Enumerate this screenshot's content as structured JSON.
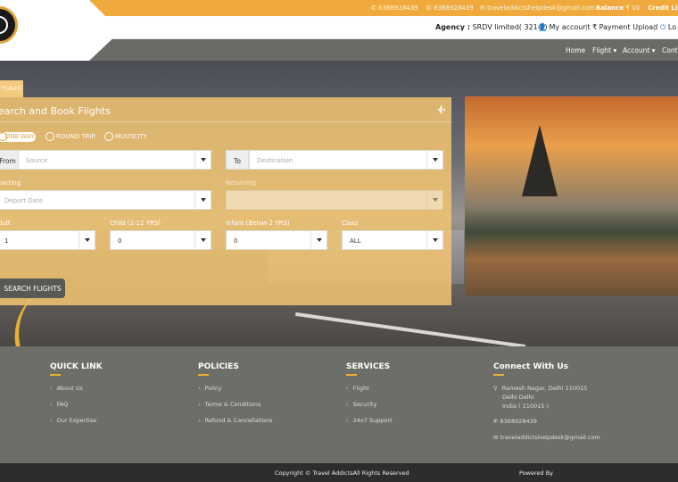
{
  "topbar": {
    "phone1": "8368928439",
    "phone2": "8368928439",
    "email": "traveladdictshelpdesk@gmail.com",
    "balance_label": "Balance",
    "balance_value": "₹ 10",
    "credit_label": "Credit Limi"
  },
  "agency": {
    "label": "Agency :",
    "name": "SRDV limited( 3214 )",
    "my_account": "My account",
    "payment_upload": "Payment Upload",
    "logout": "Lo"
  },
  "nav": {
    "items": [
      "Home",
      "Flight",
      "Account",
      "Conta"
    ]
  },
  "search": {
    "tab_label": "FLIGHT",
    "title": "earch and Book Flights",
    "trip_types": [
      "ONE WAY",
      "ROUND TRIP",
      "MULTICITY"
    ],
    "from_label": "From",
    "from_placeholder": "Source",
    "to_label": "To",
    "to_placeholder": "Destination",
    "departing_label": "parting",
    "depart_placeholder": "Depart Date",
    "returning_label": "Returning",
    "adult_label": "dult",
    "adult_value": "1",
    "child_label": "Child (2-12 YRS)",
    "child_value": "0",
    "infant_label": "Infant (Below 2 YRS)",
    "infant_value": "0",
    "class_label": "Class",
    "class_value": "ALL",
    "button": "SEARCH FLIGHTS"
  },
  "footer": {
    "quick_link": {
      "heading": "QUICK LINK",
      "items": [
        "About Us",
        "FAQ",
        "Our Expertise"
      ]
    },
    "policies": {
      "heading": "POLICIES",
      "items": [
        "Policy",
        "Terms & Conditions",
        "Refund & Cancellations"
      ]
    },
    "services": {
      "heading": "SERVICES",
      "items": [
        "Flight",
        "Security",
        "24x7 Support"
      ]
    },
    "connect": {
      "heading": "Connect With Us",
      "address_line1": "Ramesh Nagar, Delhi 110015",
      "address_line2": "Delhi Delhi",
      "address_line3": "India ( 110015 )",
      "phone": "8368928439",
      "email": "traveladdictshelpdesk@gmail.com"
    },
    "copyright": "Copyright © Travel AddictsAll Rights Reserved",
    "powered_by": "Powered By"
  },
  "colors": {
    "accent": "#f0a93c",
    "panel": "#f2c470",
    "footer": "#6e6e69",
    "bottom": "#2d2d2b"
  },
  "icons": [
    "phone-icon",
    "whatsapp-icon",
    "email-icon",
    "user-icon",
    "rupee-icon",
    "power-icon",
    "plane-icon",
    "chevron-right-icon",
    "map-pin-icon",
    "envelope-icon"
  ]
}
